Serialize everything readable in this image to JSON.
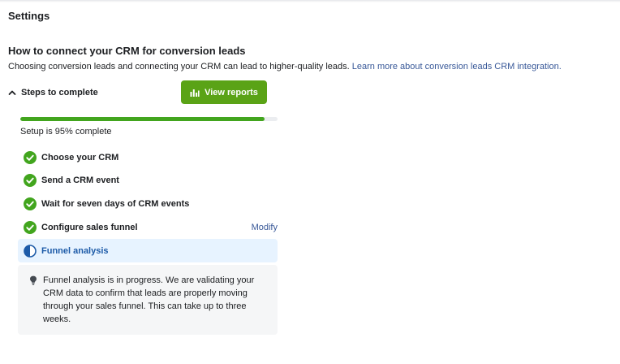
{
  "page": {
    "title": "Settings"
  },
  "section": {
    "title": "How to connect your CRM for conversion leads",
    "description": "Choosing conversion leads and connecting your CRM can lead to higher-quality leads. ",
    "learn_more_link": "Learn more about conversion leads CRM integration."
  },
  "steps_toggle": {
    "label": "Steps to complete",
    "icon": "chevron-up-icon"
  },
  "view_reports_button": {
    "label": "View reports",
    "icon": "bar-chart-icon",
    "color": "#5aa316"
  },
  "progress": {
    "percent": 95,
    "label": "Setup is 95% complete",
    "color": "#42a51e"
  },
  "steps": [
    {
      "label": "Choose your CRM",
      "status": "complete",
      "icon": "check-circle-icon"
    },
    {
      "label": "Send a CRM event",
      "status": "complete",
      "icon": "check-circle-icon"
    },
    {
      "label": "Wait for seven days of CRM events",
      "status": "complete",
      "icon": "check-circle-icon"
    },
    {
      "label": "Configure sales funnel",
      "status": "complete",
      "icon": "check-circle-icon",
      "action": "Modify"
    },
    {
      "label": "Funnel analysis",
      "status": "in-progress",
      "icon": "half-circle-icon"
    }
  ],
  "info": {
    "icon": "lightbulb-icon",
    "text": "Funnel analysis is in progress. We are validating your CRM data to confirm that leads are properly moving through your sales funnel. This can take up to three weeks."
  },
  "colors": {
    "link": "#385898",
    "active_step_bg": "#e7f3ff",
    "active_step_text": "#1d5ba8",
    "check_green": "#42a51e"
  }
}
